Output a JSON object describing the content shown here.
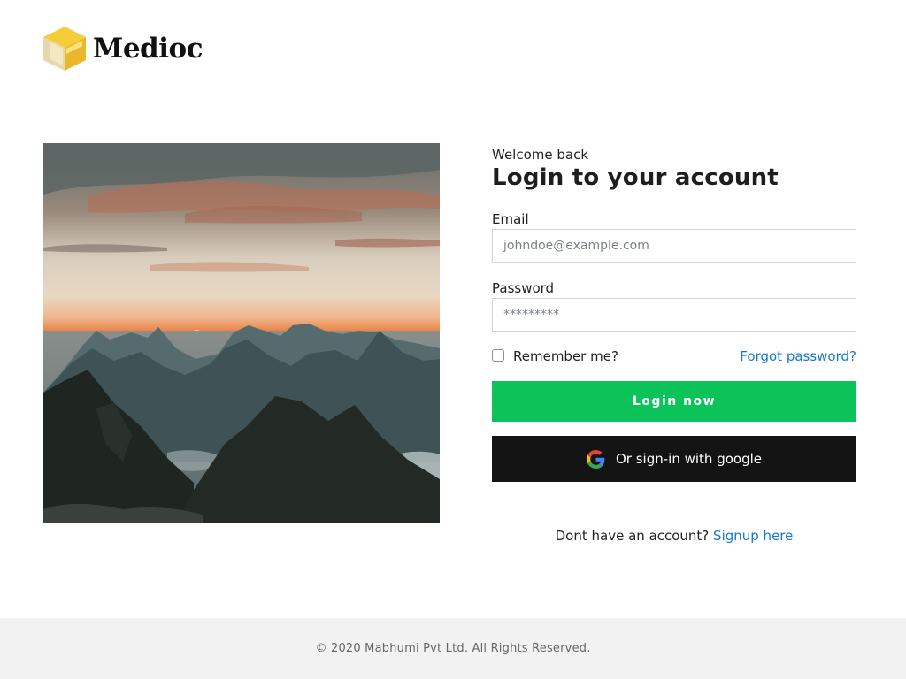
{
  "brand": {
    "name": "Medioc"
  },
  "hero_image": {
    "subject": "sunset over mountain peaks and lakes"
  },
  "login": {
    "welcome": "Welcome back",
    "title": "Login to your account",
    "email_label": "Email",
    "email_placeholder": "johndoe@example.com",
    "password_label": "Password",
    "password_placeholder": "*********",
    "remember_label": "Remember me?",
    "remember_checked": false,
    "forgot_label": "Forgot password?",
    "login_button": "Login now",
    "google_button": "Or sign-in with google",
    "signup_prompt": "Dont have an account?",
    "signup_link": "Signup here"
  },
  "footer": {
    "copyright": "© 2020 Mabhumi Pvt Ltd. All Rights Reserved."
  },
  "colors": {
    "primary_button": "#0cc35a",
    "google_button": "#141414",
    "link": "#1479cc",
    "footer_bg": "#f2f2f2",
    "logo_accent": "#f2c230"
  }
}
